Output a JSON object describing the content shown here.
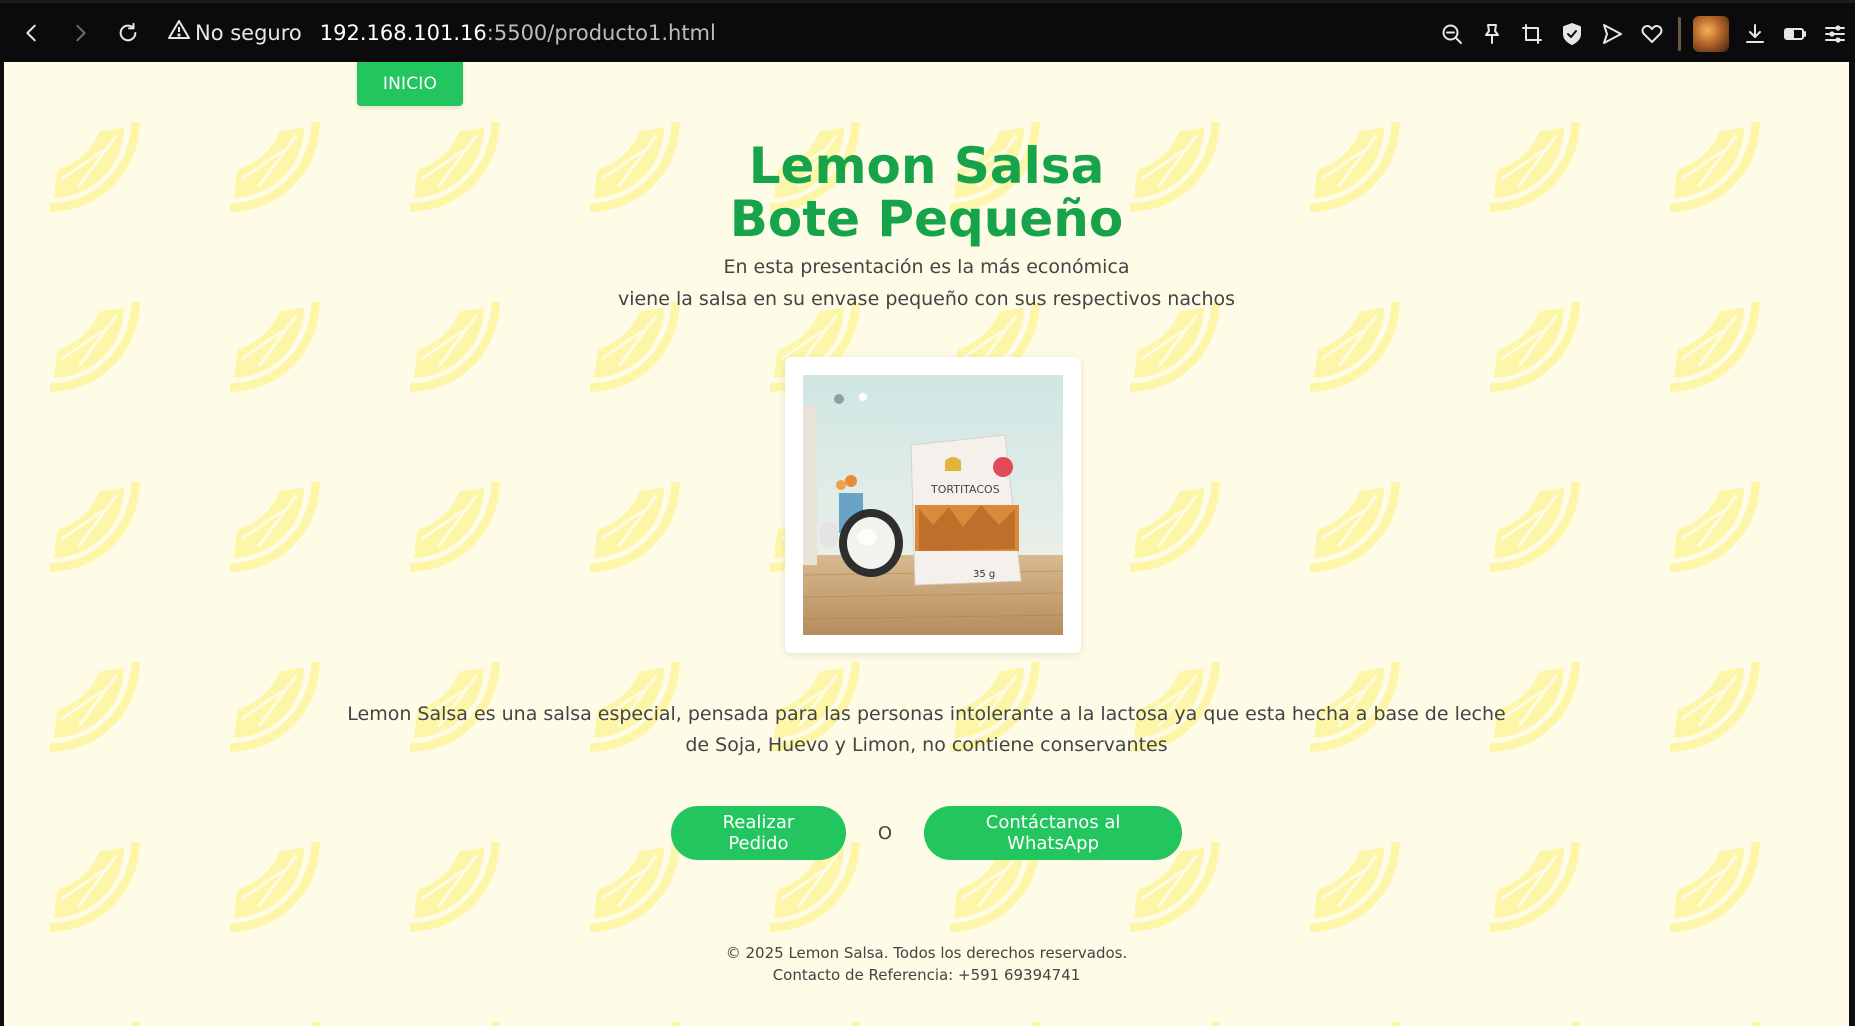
{
  "browser": {
    "security_label": "No seguro",
    "url_host": "192.168.101.16",
    "url_path": ":5500/producto1.html",
    "toolbar_icons": [
      "back-icon",
      "forward-icon",
      "reload-icon",
      "warning-icon",
      "zoom-out-icon",
      "pin-icon",
      "screenshot-icon",
      "shield-icon",
      "send-icon",
      "heart-icon",
      "download-icon",
      "battery-icon",
      "menu-icon"
    ]
  },
  "nav": {
    "home_label": "INICIO"
  },
  "hero": {
    "title_line1": "Lemon Salsa",
    "title_line2": "Bote Pequeño",
    "subtitle_line1": "En esta presentación es la más económica",
    "subtitle_line2": "viene la salsa en su envase pequeño con sus respectivos nachos"
  },
  "product": {
    "package_brand": "TORTITACOS",
    "package_weight": "35 g"
  },
  "description": "Lemon Salsa es una salsa especial, pensada para las personas intolerante a la lactosa ya que esta hecha a base de leche de Soja, Huevo y Limon, no contiene conservantes",
  "actions": {
    "order_label": "Realizar Pedido",
    "separator": "O",
    "whatsapp_label": "Contáctanos al WhatsApp"
  },
  "footer": {
    "copyright": "© 2025 Lemon Salsa. Todos los derechos reservados.",
    "contact": "Contacto de Referencia: +591 69394741"
  },
  "colors": {
    "accent": "#22c55e",
    "title": "#16a34a",
    "page_bg": "#fefbe6",
    "lemon_pattern": "#fdf6a8",
    "text": "#444444"
  }
}
